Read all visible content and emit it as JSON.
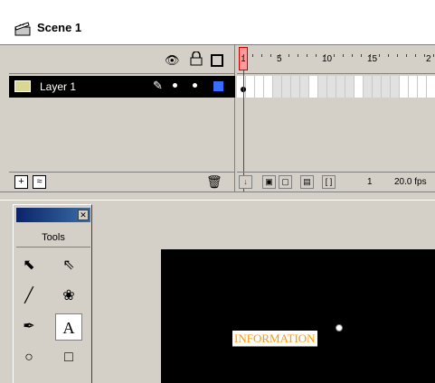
{
  "scene": {
    "label": "Scene 1",
    "icon": "clapperboard-icon"
  },
  "layers": {
    "header_icons": [
      "eye-icon",
      "lock-icon",
      "outline-icon"
    ],
    "items": [
      {
        "name": "Layer 1",
        "selected": true,
        "color": "#3a6cff"
      }
    ],
    "footer_icons": [
      "add-layer-icon",
      "add-guide-layer-icon",
      "trash-icon"
    ]
  },
  "timeline": {
    "current_frame": "1",
    "ruler_labels": [
      "1",
      "5",
      "10",
      "15",
      "2"
    ],
    "frame_number": "1",
    "frame_rate": "20.0 fps"
  },
  "stage": {
    "text_content": "INFORMATION",
    "text_color": "#ff9900",
    "stage_color": "#000000"
  },
  "tools": {
    "label": "Tools",
    "items": [
      "arrow-tool",
      "subselect-tool",
      "line-tool",
      "lasso-tool",
      "pen-tool",
      "text-tool",
      "oval-tool",
      "rectangle-tool"
    ],
    "selected": "text-tool"
  }
}
